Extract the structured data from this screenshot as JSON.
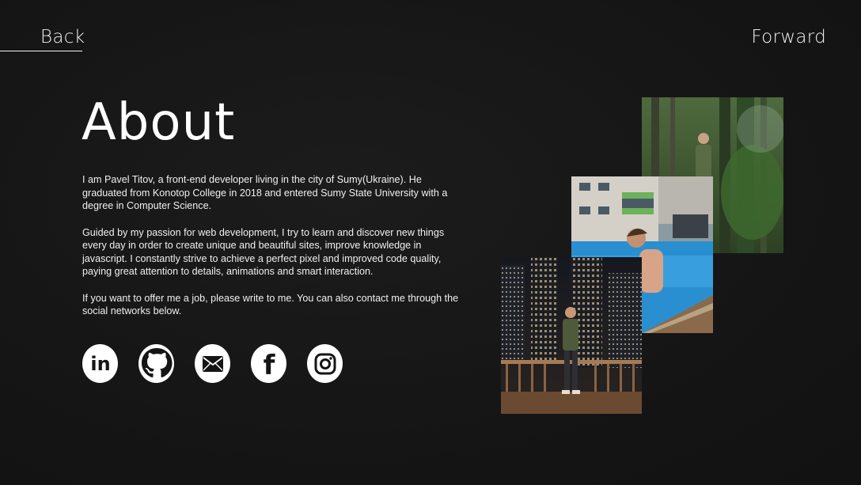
{
  "nav": {
    "back_label": "Back",
    "forward_label": "Forward"
  },
  "page": {
    "title": "About",
    "paragraphs": [
      "I am Pavel Titov, a front-end developer living in the city of Sumy(Ukraine). He graduated from Konotop College in 2018 and entered Sumy State University with a degree in Computer Science.",
      "Guided by my passion for web development, I try to learn and discover new things every day in order to create unique and beautiful sites, improve knowledge in javascript. I constantly strive to achieve a perfect pixel and improved code quality, paying great attention to details, animations and smart interaction.",
      "If you want to offer me a job, please write to me. You can also contact me through the social networks below."
    ]
  },
  "social": {
    "icons": [
      "linkedin-icon",
      "github-icon",
      "mail-icon",
      "facebook-icon",
      "instagram-icon"
    ],
    "linkedin_text": "in",
    "facebook_text": "f"
  },
  "photos": {
    "items": [
      "forest-photo",
      "pool-photo",
      "city-photo"
    ]
  },
  "colors": {
    "background": "#151515",
    "text": "#f2f2f2",
    "icon_bg": "#ffffff",
    "icon_fg": "#151515"
  }
}
